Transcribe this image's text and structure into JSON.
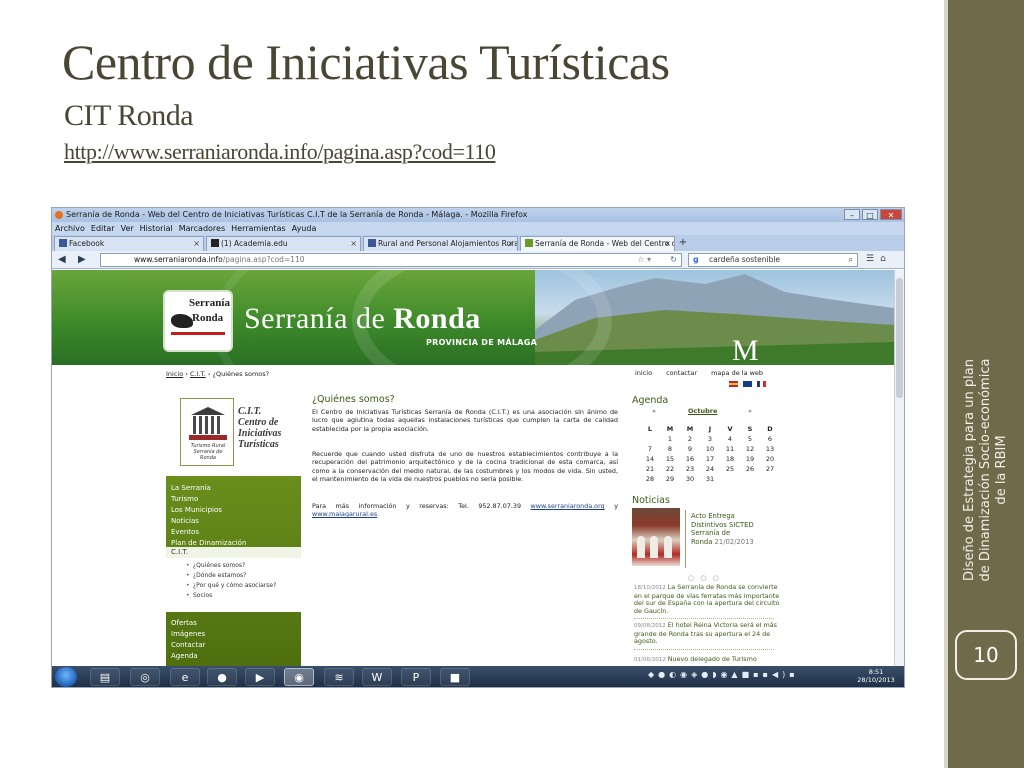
{
  "slide": {
    "title": "Centro de Iniciativas Turísticas",
    "subtitle": "CIT Ronda",
    "url": "http://www.serraniaronda.info/pagina.asp?cod=110",
    "side_text": "Diseño de Estrategia  para un plan de Dinamización Socio-económica de la RBIM",
    "page_number": "10"
  },
  "browser": {
    "window_title": "Serranía de Ronda - Web del Centro de Iniciativas Turísticas C.I.T de la Serranía de Ronda - Málaga. - Mozilla Firefox",
    "menu": [
      "Archivo",
      "Editar",
      "Ver",
      "Historial",
      "Marcadores",
      "Herramientas",
      "Ayuda"
    ],
    "tabs": [
      {
        "label": "Facebook"
      },
      {
        "label": "(1) Academia.edu"
      },
      {
        "label": "Rural and Personal Alojamientos Rura..."
      },
      {
        "label": "Serranía de Ronda - Web del Centro d..."
      }
    ],
    "url_base": "www.serraniaronda.info",
    "url_rest": "/pagina.asp?cod=110",
    "search_value": "cardeña sostenible",
    "search_engine_icon": "g"
  },
  "site": {
    "logo_line1": "Serranía",
    "logo_line2": "Ronda",
    "brand_prefix": "Serranía de ",
    "brand_bold": "Ronda",
    "province": "PROVINCIA DE MÁLAGA",
    "m_logo": "M",
    "breadcrumb": {
      "home": "Inicio",
      "sep": " › ",
      "section": "C.I.T.",
      "current": "¿Quiénes somos?"
    },
    "topnav": [
      "inicio",
      "contactar",
      "mapa de la web"
    ],
    "flag_colors": [
      "#c8232c",
      "#f2c230",
      "#1a3b8c",
      "#ffffff",
      "#1a3b8c",
      "#d82a2a"
    ],
    "cit_lines": [
      "C.I.T.",
      "Centro de",
      "Iniciativas",
      "Turísticas"
    ],
    "cit_logo_caption": "Turismo Rural Serranía de Ronda",
    "menu_items": [
      "La Serranía",
      "Turismo",
      "Los Municipios",
      "Noticias",
      "Eventos",
      "Plan de Dinamización"
    ],
    "menu_selected": "C.I.T.",
    "submenu": [
      "¿Quiénes somos?",
      "¿Dónde estamos?",
      "¿Por qué y cómo asociarse?",
      "Socios"
    ],
    "menu_items_2": [
      "Ofertas",
      "Imágenes",
      "Contactar",
      "Agenda"
    ],
    "who_title": "¿Quiénes somos?",
    "para1": "El Centro de Iniciativas Turísticas Serranía de Ronda (C.I.T.) es una asociación sin ánimo de lucro que aglutina todas aquellas instalaciones turísticas que cumplen la carta de calidad establecida por la propia asociación.",
    "para2": "Recuerde que cuando usted disfruta de uno de nuestros establecimientos contribuye a la recuperación del patrimonio arquitectónico y de la cocina tradicional de esta comarca, así como a la conservación del medio natural, de las costumbres y los modos de vida. Sin usted, el mantenimiento de la vida de nuestros pueblos no sería posible.",
    "para3_text": "Para más información y reservas: Tel. 952.87.07.39",
    "para3_link1": "www.serraniaronda.org",
    "para3_y": "y",
    "para3_link2": "www.malagarural.es",
    "agenda_title": "Agenda",
    "cal_prev": "«",
    "cal_month": "Octubre",
    "cal_next": "»",
    "cal_days": [
      "L",
      "M",
      "M",
      "J",
      "V",
      "S",
      "D"
    ],
    "cal_weeks": [
      [
        "",
        "1",
        "2",
        "3",
        "4",
        "5",
        "6"
      ],
      [
        "7",
        "8",
        "9",
        "10",
        "11",
        "12",
        "13"
      ],
      [
        "14",
        "15",
        "16",
        "17",
        "18",
        "19",
        "20"
      ],
      [
        "21",
        "22",
        "23",
        "24",
        "25",
        "26",
        "27"
      ],
      [
        "28",
        "29",
        "30",
        "31",
        "",
        "",
        ""
      ]
    ],
    "news_title": "Noticias",
    "news_main_lines": [
      "Acto Entrega",
      "Distintivos SICTED",
      "Serranía de",
      "Ronda"
    ],
    "news_main_date": "21/02/2013",
    "news_dots": "○ ○ ○",
    "news_list": [
      {
        "date": "18/10/2012",
        "text": "La Serranía de Ronda se convierte en el parque de vías ferratas más importante del sur de España con la apertura del circuito de Gaucín."
      },
      {
        "date": "09/08/2012",
        "text": "El hotel Reina Victoria será el más grande de Ronda tras su apertura el 24 de agosto."
      },
      {
        "date": "01/06/2012",
        "text": "Nuevo delegado de Turismo"
      }
    ]
  },
  "taskbar": {
    "clock_time": "8:51",
    "clock_date": "28/10/2013"
  }
}
